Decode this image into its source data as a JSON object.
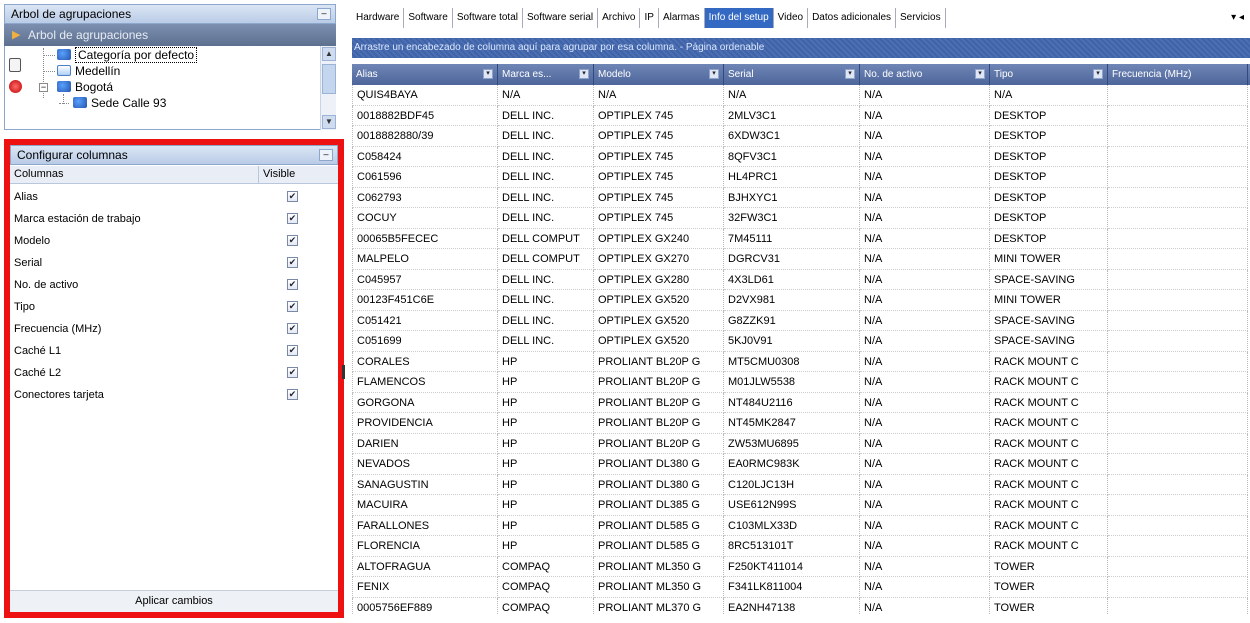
{
  "tree_panel": {
    "title": "Arbol de agrupaciones",
    "header": "Arbol de agrupaciones",
    "nodes": [
      "Categoría por defecto",
      "Medellín",
      "Bogotá",
      "Sede Calle 93"
    ]
  },
  "columns_panel": {
    "title": "Configurar columnas",
    "header_columns": "Columnas",
    "header_visible": "Visible",
    "items": [
      {
        "name": "Alias",
        "visible": true
      },
      {
        "name": "Marca estación de trabajo",
        "visible": true
      },
      {
        "name": "Modelo",
        "visible": true
      },
      {
        "name": "Serial",
        "visible": true
      },
      {
        "name": "No. de activo",
        "visible": true
      },
      {
        "name": "Tipo",
        "visible": true
      },
      {
        "name": "Frecuencia (MHz)",
        "visible": true
      },
      {
        "name": "Caché L1",
        "visible": true
      },
      {
        "name": "Caché L2",
        "visible": true
      },
      {
        "name": "Conectores tarjeta",
        "visible": true
      }
    ],
    "apply_label": "Aplicar cambios"
  },
  "tabs": [
    "Hardware",
    "Software",
    "Software total",
    "Software serial",
    "Archivo",
    "IP",
    "Alarmas",
    "Info del setup",
    "Video",
    "Datos adicionales",
    "Servicios"
  ],
  "active_tab": "Info del setup",
  "group_hint": "Arrastre un encabezado de columna aquí para agrupar por esa columna. - Página ordenable",
  "grid": {
    "columns": [
      "Alias",
      "Marca es...",
      "Modelo",
      "Serial",
      "No. de activo",
      "Tipo",
      "Frecuencia (MHz)"
    ],
    "rows": [
      [
        "QUIS4BAYA",
        "N/A",
        "N/A",
        "N/A",
        "N/A",
        "N/A",
        ""
      ],
      [
        "0018882BDF45",
        "DELL INC.",
        "OPTIPLEX 745",
        "2MLV3C1",
        "N/A",
        "DESKTOP",
        ""
      ],
      [
        "0018882880/39",
        "DELL INC.",
        "OPTIPLEX 745",
        "6XDW3C1",
        "N/A",
        "DESKTOP",
        ""
      ],
      [
        "C058424",
        "DELL INC.",
        "OPTIPLEX 745",
        "8QFV3C1",
        "N/A",
        "DESKTOP",
        ""
      ],
      [
        "C061596",
        "DELL INC.",
        "OPTIPLEX 745",
        "HL4PRC1",
        "N/A",
        "DESKTOP",
        ""
      ],
      [
        "C062793",
        "DELL INC.",
        "OPTIPLEX 745",
        "BJHXYC1",
        "N/A",
        "DESKTOP",
        ""
      ],
      [
        "COCUY",
        "DELL INC.",
        "OPTIPLEX 745",
        "32FW3C1",
        "N/A",
        "DESKTOP",
        ""
      ],
      [
        "00065B5FECEC",
        "DELL COMPUT",
        "OPTIPLEX GX240",
        "7M45111",
        "N/A",
        "DESKTOP",
        ""
      ],
      [
        "MALPELO",
        "DELL COMPUT",
        "OPTIPLEX GX270",
        "DGRCV31",
        "N/A",
        "MINI TOWER",
        ""
      ],
      [
        "C045957",
        "DELL INC.",
        "OPTIPLEX GX280",
        "4X3LD61",
        "N/A",
        "SPACE-SAVING",
        ""
      ],
      [
        "00123F451C6E",
        "DELL INC.",
        "OPTIPLEX GX520",
        "D2VX981",
        "N/A",
        "MINI TOWER",
        ""
      ],
      [
        "C051421",
        "DELL INC.",
        "OPTIPLEX GX520",
        "G8ZZK91",
        "N/A",
        "SPACE-SAVING",
        ""
      ],
      [
        "C051699",
        "DELL INC.",
        "OPTIPLEX GX520",
        "5KJ0V91",
        "N/A",
        "SPACE-SAVING",
        ""
      ],
      [
        "CORALES",
        "HP",
        "PROLIANT BL20P G",
        "MT5CMU0308",
        "N/A",
        "RACK MOUNT C",
        ""
      ],
      [
        "FLAMENCOS",
        "HP",
        "PROLIANT BL20P G",
        "M01JLW5538",
        "N/A",
        "RACK MOUNT C",
        ""
      ],
      [
        "GORGONA",
        "HP",
        "PROLIANT BL20P G",
        "NT484U2116",
        "N/A",
        "RACK MOUNT C",
        ""
      ],
      [
        "PROVIDENCIA",
        "HP",
        "PROLIANT BL20P G",
        "NT45MK2847",
        "N/A",
        "RACK MOUNT C",
        ""
      ],
      [
        "DARIEN",
        "HP",
        "PROLIANT BL20P G",
        "ZW53MU6895",
        "N/A",
        "RACK MOUNT C",
        ""
      ],
      [
        "NEVADOS",
        "HP",
        "PROLIANT DL380 G",
        "EA0RMC983K",
        "N/A",
        "RACK MOUNT C",
        ""
      ],
      [
        "SANAGUSTIN",
        "HP",
        "PROLIANT DL380 G",
        "C120LJC13H",
        "N/A",
        "RACK MOUNT C",
        ""
      ],
      [
        "MACUIRA",
        "HP",
        "PROLIANT DL385 G",
        "USE612N99S",
        "N/A",
        "RACK MOUNT C",
        ""
      ],
      [
        "FARALLONES",
        "HP",
        "PROLIANT DL585 G",
        "C103MLX33D",
        "N/A",
        "RACK MOUNT C",
        ""
      ],
      [
        "FLORENCIA",
        "HP",
        "PROLIANT DL585 G",
        "8RC513101T",
        "N/A",
        "RACK MOUNT C",
        ""
      ],
      [
        "ALTOFRAGUA",
        "COMPAQ",
        "PROLIANT ML350 G",
        "F250KT411014",
        "N/A",
        "TOWER",
        ""
      ],
      [
        "FENIX",
        "COMPAQ",
        "PROLIANT ML350 G",
        "F341LK811004",
        "N/A",
        "TOWER",
        ""
      ],
      [
        "0005756EF889",
        "COMPAQ",
        "PROLIANT ML370 G",
        "EA2NH47138",
        "N/A",
        "TOWER",
        ""
      ]
    ]
  },
  "colors": {
    "highlight_border": "#ee1111",
    "grid_header": "#4d659a",
    "active_tab": "#3469c3"
  }
}
